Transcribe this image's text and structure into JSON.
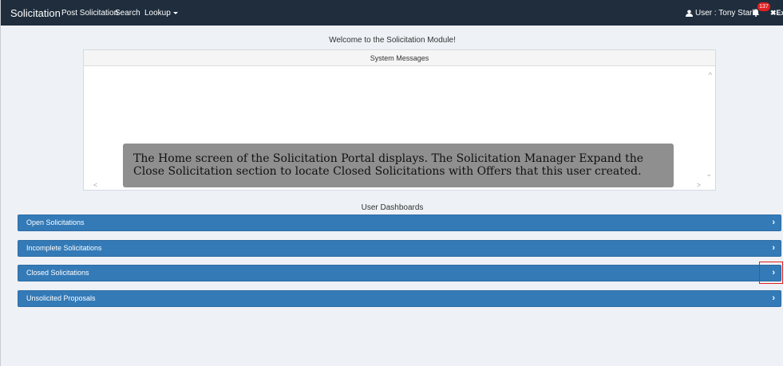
{
  "navbar": {
    "brand": "Solicitation",
    "links": [
      "Post Solicitation",
      "Search",
      "Lookup"
    ],
    "user_label": "User : Tony Stark",
    "notification_count": "137",
    "exit_label": "Ex"
  },
  "welcome": "Welcome to the Solicitation Module!",
  "system_messages": {
    "title": "System Messages"
  },
  "caption": "The Home screen of the Solicitation Portal displays. The Solicitation Manager Expand the Close Solicitation section to locate Closed Solicitations with Offers that this user created.",
  "dashboards": {
    "title": "User Dashboards",
    "items": [
      {
        "label": "Open Solicitations"
      },
      {
        "label": "Incomplete Solicitations"
      },
      {
        "label": "Closed Solicitations"
      },
      {
        "label": "Unsolicited Proposals"
      }
    ]
  },
  "colors": {
    "navbar": "#1f2d3d",
    "dashboard_bar": "#337ab7",
    "badge": "#e02020",
    "highlight": "#e02020"
  }
}
